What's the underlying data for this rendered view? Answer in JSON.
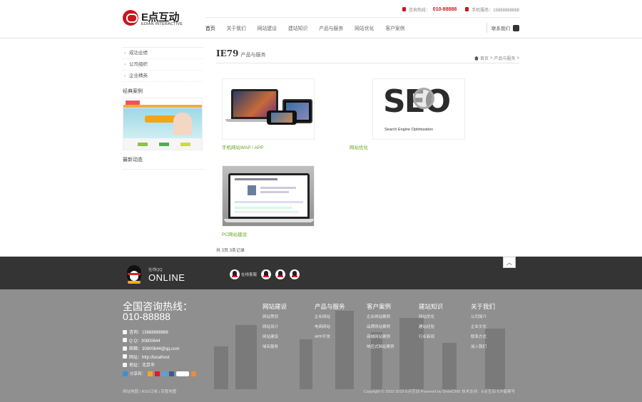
{
  "logo": {
    "cn": "E点互动",
    "en": "EDIAN INTERACTIVE"
  },
  "topbar": {
    "hotline_label": "咨询热线：",
    "hotline_number": "010-88888",
    "phone_label": "手机服务：15888888888"
  },
  "nav": {
    "items": [
      "首页",
      "关于我们",
      "网站建设",
      "建站知识",
      "产品与服务",
      "网站优化",
      "客户案例"
    ],
    "contact": "联系我们"
  },
  "sidebar": {
    "items": [
      "成功业绩",
      "公司组织",
      "企业精英"
    ],
    "case_heading": "经典案例",
    "news_heading": "最新动态"
  },
  "main": {
    "title": "IE79",
    "title_sub": "产品与服务",
    "breadcrumb": [
      "首页",
      ">",
      "产品与服务",
      ">"
    ],
    "products": [
      {
        "label": "手机网站WAP / APP"
      },
      {
        "label": "网站优化",
        "image_text": "SEO",
        "image_caption": "Search Engine Optimization"
      },
      {
        "label": "PC网站建设"
      }
    ],
    "pagination": "共 3页 3条记录"
  },
  "online": {
    "small_label": "在线QQ",
    "label": "ONLINE",
    "qq_items": [
      "在线客服",
      "",
      "",
      ""
    ]
  },
  "footer": {
    "hotline_title": "全国咨询热线：",
    "hotline_number": "010-88888",
    "contacts": [
      {
        "icon": "user-icon",
        "text": "咨询：15888888888"
      },
      {
        "icon": "qq-icon",
        "text": "Q Q：30800644"
      },
      {
        "icon": "mail-icon",
        "text": "邮箱：30800644@qq.com"
      },
      {
        "icon": "link-icon",
        "text": "网址：http://localhost"
      },
      {
        "icon": "location-icon",
        "text": "地址：北京市"
      }
    ],
    "share_label": "分享到：",
    "columns": [
      {
        "title": "网站建设",
        "links": [
          "网站策划",
          "网站设计",
          "网站建设",
          "域名服务"
        ]
      },
      {
        "title": "产品与服务",
        "links": [
          "企业网站",
          "电商网站",
          "APP开发"
        ]
      },
      {
        "title": "客户案例",
        "links": [
          "企业网站案例",
          "品牌网站案例",
          "商城网站案例",
          "响应式网站案例"
        ]
      },
      {
        "title": "建站知识",
        "links": [
          "网站优化",
          "建站经验",
          "行业新闻"
        ]
      },
      {
        "title": "关于我们",
        "links": [
          "公司简介",
          "企业文化",
          "联系方式",
          "加入我们"
        ]
      }
    ],
    "bottom_left": "网站地图 | RSS订阅 | 百度地图",
    "bottom_right": "Copyright © 2002-2019 E点互动 Powered by DedeCMS   技术支持：E点互动   ICP备案号"
  },
  "colors": {
    "brand_red": "#c9151e",
    "label_green": "#6aa521",
    "online_bg": "#343434",
    "footer_bg": "#8f8f8f"
  }
}
